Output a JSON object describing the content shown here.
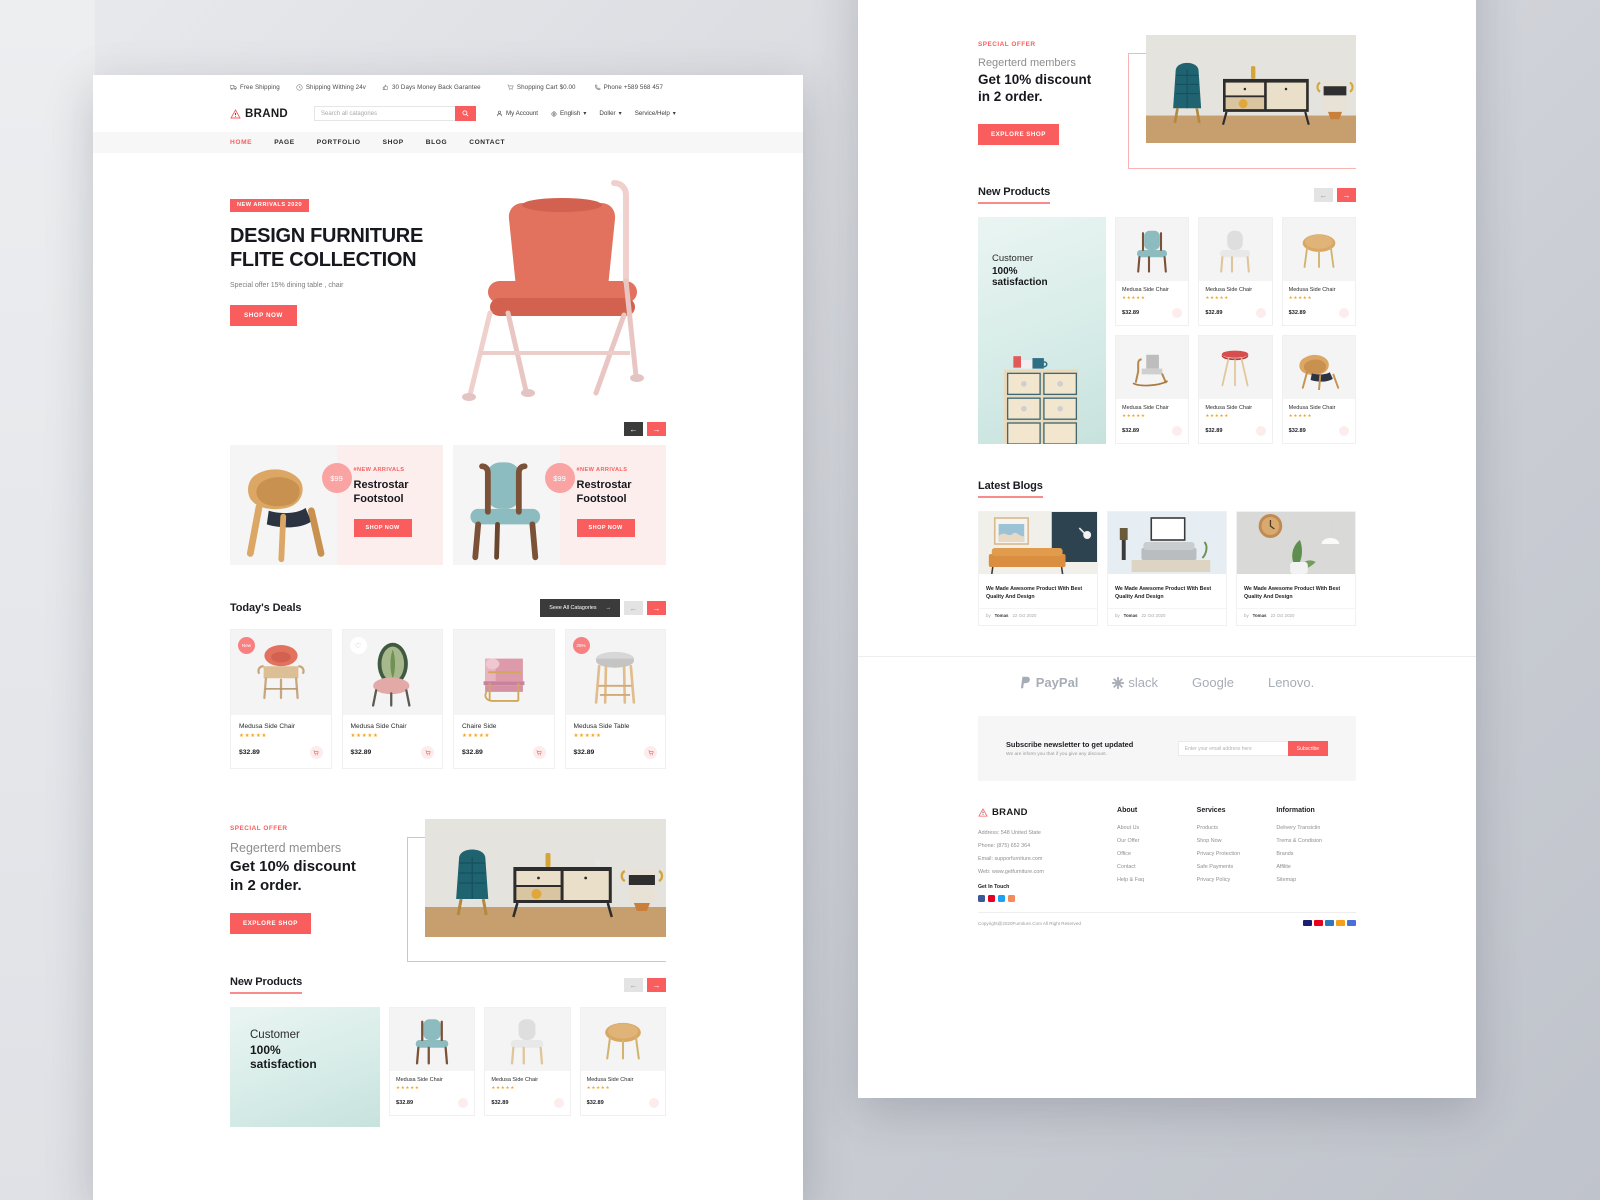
{
  "topbar": {
    "left": [
      {
        "icon": "truck-icon",
        "label": "Free Shipping"
      },
      {
        "icon": "clock-icon",
        "label": "Shipping Withing 24v"
      },
      {
        "icon": "thumbs-up-icon",
        "label": "30 Days Money Back Garantee"
      }
    ],
    "cart": {
      "icon": "cart-icon",
      "label": "Shopping Cart $0.00"
    },
    "phone": {
      "icon": "phone-icon",
      "label": "Phone +589 568 457"
    }
  },
  "header": {
    "brand": "BRAND",
    "search_placeholder": "Search all catagories",
    "search_value": "",
    "search_icon": "search-icon",
    "account": "My Account",
    "language": "English",
    "currency": "Doller",
    "service": "Service/Help"
  },
  "nav": {
    "items": [
      {
        "label": "HOME",
        "active": true
      },
      {
        "label": "PAGE",
        "active": false
      },
      {
        "label": "PORTFOLIO",
        "active": false
      },
      {
        "label": "SHOP",
        "active": false
      },
      {
        "label": "BLOG",
        "active": false
      },
      {
        "label": "CONTACT",
        "active": false
      }
    ]
  },
  "hero": {
    "badge": "NEW ARRIVALS 2020",
    "title_line1": "DESIGN FURNITURE",
    "title_line2": "FLITE COLLECTION",
    "subtitle": "Special offer 15% dining table , chair",
    "cta": "SHOP NOW",
    "prev_icon": "arrow-left-icon",
    "next_icon": "arrow-right-icon"
  },
  "promos": [
    {
      "price": "$99",
      "tag": "#NEW ARRIVALS",
      "title_l1": "Restrostar",
      "title_l2": "Footstool",
      "cta": "SHOP NOW"
    },
    {
      "price": "$99",
      "tag": "#NEW ARRIVALS",
      "title_l1": "Restrostar",
      "title_l2": "Footstool",
      "cta": "SHOP NOW"
    }
  ],
  "deals": {
    "title": "Today's Deals",
    "see_all": "Seee All Catagories",
    "see_all_icon": "arrow-right-icon",
    "prev_icon": "arrow-left-icon",
    "next_icon": "arrow-right-icon",
    "products": [
      {
        "badge": "New",
        "badge_type": "red",
        "name": "Medusa Side Chair",
        "stars": "★★★★★",
        "price": "$32.89",
        "cart_icon": "cart-icon"
      },
      {
        "badge": "♡",
        "badge_type": "white",
        "name": "Medusa Side Chair",
        "stars": "★★★★★",
        "price": "$32.89",
        "cart_icon": "cart-icon"
      },
      {
        "badge": "",
        "badge_type": "none",
        "name": "Chaire Side",
        "stars": "★★★★★",
        "price": "$32.89",
        "cart_icon": "cart-icon"
      },
      {
        "badge": "25%",
        "badge_type": "red",
        "name": "Medusa Side Table",
        "stars": "★★★★★",
        "price": "$32.89",
        "cart_icon": "cart-icon"
      }
    ]
  },
  "offer": {
    "kicker": "SPECIAL OFFER",
    "line1": "Regerterd members",
    "line2_a": "Get 10% discount",
    "line2_b": "in 2 order.",
    "cta": "EXPLORE SHOP"
  },
  "new_products": {
    "title": "New Products",
    "prev_icon": "arrow-left-icon",
    "next_icon": "arrow-right-icon",
    "promo": {
      "l1": "Customer",
      "l2": "100%",
      "l3": "satisfaction"
    },
    "items": [
      {
        "name": "Medusa Side Chair",
        "stars": "★★★★★",
        "price": "$32.89",
        "cart_icon": "cart-icon"
      },
      {
        "name": "Medusa Side Chair",
        "stars": "★★★★★",
        "price": "$32.89",
        "cart_icon": "cart-icon"
      },
      {
        "name": "Medusa Side Chair",
        "stars": "★★★★★",
        "price": "$32.89",
        "cart_icon": "cart-icon"
      },
      {
        "name": "Medusa Side Chair",
        "stars": "★★★★★",
        "price": "$32.89",
        "cart_icon": "cart-icon"
      },
      {
        "name": "Medusa Side Chair",
        "stars": "★★★★★",
        "price": "$32.89",
        "cart_icon": "cart-icon"
      },
      {
        "name": "Medusa Side Chair",
        "stars": "★★★★★",
        "price": "$32.89",
        "cart_icon": "cart-icon"
      }
    ]
  },
  "blogs": {
    "title": "Latest Blogs",
    "posts": [
      {
        "title": "We Made Awesome Product With Best Quality And Design",
        "by": "by",
        "author": "Tomas",
        "date": "22 Oct 2020"
      },
      {
        "title": "We Made Awesome Product With Best Quality And Design",
        "by": "by",
        "author": "Tomas",
        "date": "22 Oct 2020"
      },
      {
        "title": "We Made Awesome Product With Best Quality And Design",
        "by": "by",
        "author": "Tomas",
        "date": "22 Oct 2020"
      }
    ]
  },
  "brands": [
    {
      "name": "PayPal",
      "icon": "paypal-icon"
    },
    {
      "name": "slack",
      "icon": "slack-icon"
    },
    {
      "name": "Google",
      "icon": "google-icon"
    },
    {
      "name": "Lenovo.",
      "icon": "lenovo-icon"
    }
  ],
  "newsletter": {
    "heading": "Subscribe newsletter to get updated",
    "sub": "We are inform  you that if you give any discount.",
    "placeholder": "Enter your email address here",
    "value": "",
    "button": "Subscribe"
  },
  "footer": {
    "brand": "BRAND",
    "address": "Address: 548 United State",
    "phone": "Phone: (875) 652 364",
    "email": "Email: supporfurniture.com",
    "web": "Web: www.getfurniture.com",
    "get_in_touch": "Get In Touch",
    "columns": [
      {
        "heading": "About",
        "links": [
          "About Us",
          "Our Offer",
          "Office",
          "Contact",
          "Help & Faq"
        ]
      },
      {
        "heading": "Services",
        "links": [
          "Products",
          "Shop Now",
          "Privacy Protection",
          "Safe Payments",
          "Privacy Policy"
        ]
      },
      {
        "heading": "Information",
        "links": [
          "Delivery Transictin",
          "Trems & Condision",
          "Brands",
          "Affilite",
          "Sitemap"
        ]
      }
    ],
    "copyright": "Copyright@2020Furniture.Com All Right Reserved"
  },
  "colors": {
    "accent": "#fa5d5d",
    "dark": "#3b3b3b",
    "star": "#f5a623",
    "panel": "#ffffff"
  }
}
